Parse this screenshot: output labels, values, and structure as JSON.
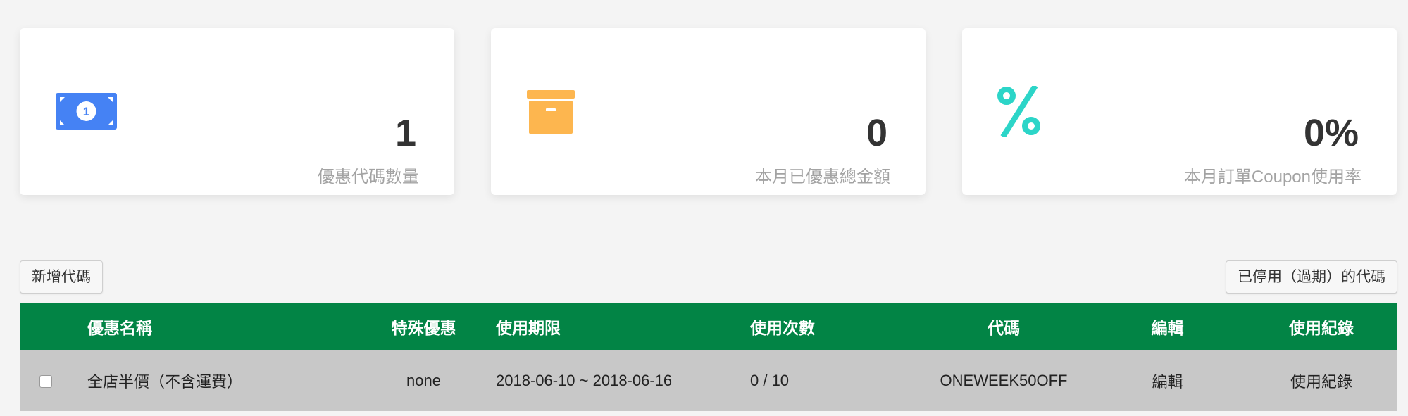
{
  "stats": [
    {
      "value": "1",
      "label": "優惠代碼數量",
      "icon": "money-bill-icon",
      "color": "#4582f4"
    },
    {
      "value": "0",
      "label": "本月已優惠總金額",
      "icon": "archive-box-icon",
      "color": "#fdb64f"
    },
    {
      "value": "0%",
      "label": "本月訂單Coupon使用率",
      "icon": "percent-icon",
      "color": "#2cd5c8"
    }
  ],
  "toolbar": {
    "add_label": "新增代碼",
    "disabled_label": "已停用（過期）的代碼"
  },
  "table": {
    "headers": {
      "name": "優惠名稱",
      "special": "特殊優惠",
      "period": "使用期限",
      "usage": "使用次數",
      "code": "代碼",
      "edit": "編輯",
      "log": "使用紀錄"
    },
    "rows": [
      {
        "checked": false,
        "name": "全店半價（不含運費）",
        "special": "none",
        "period": "2018-06-10 ~ 2018-06-16",
        "usage": "0 / 10",
        "code": "ONEWEEK50OFF",
        "edit": "編輯",
        "log": "使用紀錄"
      }
    ]
  },
  "colors": {
    "header_bg": "#028445",
    "row_bg": "#c8c8c8",
    "page_bg": "#f4f4f4"
  }
}
